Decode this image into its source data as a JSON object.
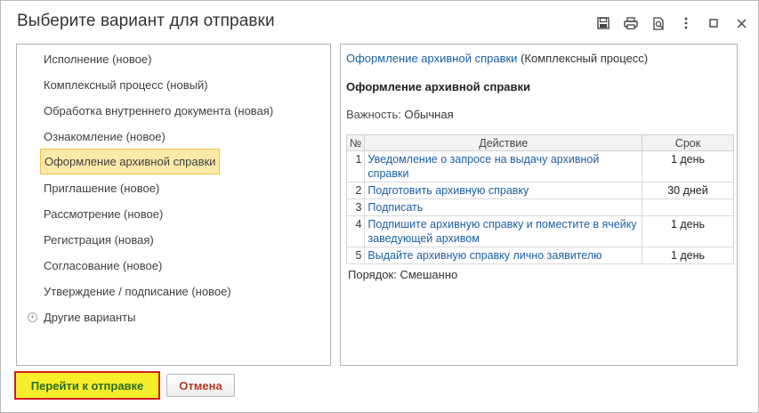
{
  "window": {
    "title": "Выберите вариант для отправки"
  },
  "toolbar_icons": [
    "save-icon",
    "print-icon",
    "preview-icon",
    "more-icon",
    "maximize-icon",
    "close-icon"
  ],
  "tree": {
    "items": [
      {
        "label": "Исполнение (новое)"
      },
      {
        "label": "Комплексный процесс (новый)"
      },
      {
        "label": "Обработка внутреннего документа (новая)"
      },
      {
        "label": "Ознакомление (новое)"
      },
      {
        "label": "Оформление архивной справки",
        "selected": true
      },
      {
        "label": "Приглашение (новое)"
      },
      {
        "label": "Рассмотрение (новое)"
      },
      {
        "label": "Регистрация (новая)"
      },
      {
        "label": "Согласование (новое)"
      },
      {
        "label": "Утверждение / подписание (новое)"
      }
    ],
    "other_group": "Другие варианты"
  },
  "details": {
    "header_link": "Оформление архивной справки",
    "header_suffix": "(Комплексный процесс)",
    "title": "Оформление архивной справки",
    "importance_label": "Важность:",
    "importance_value": "Обычная",
    "table": {
      "headers": [
        "№",
        "Действие",
        "Срок"
      ],
      "rows": [
        {
          "num": "1",
          "action": "Уведомление о запросе на выдачу архивной справки",
          "term": "1 день"
        },
        {
          "num": "2",
          "action": "Подготовить архивную справку",
          "term": "30 дней"
        },
        {
          "num": "3",
          "action": "Подписать",
          "term": ""
        },
        {
          "num": "4",
          "action": "Подпишите архивную справку и поместите в ячейку заведующей архивом",
          "term": "1 день"
        },
        {
          "num": "5",
          "action": "Выдайте архивную справку лично заявителю",
          "term": "1 день"
        }
      ]
    },
    "order_label": "Порядок:",
    "order_value": "Смешанно"
  },
  "buttons": {
    "go_label": "Перейти к отправке",
    "cancel_label": "Отмена"
  },
  "colors": {
    "link": "#1a5fa3",
    "selected_bg": "#fbe9a8",
    "primary_bg": "#f6ee2b",
    "primary_border": "#d11b20",
    "cancel_text": "#b53a25"
  }
}
